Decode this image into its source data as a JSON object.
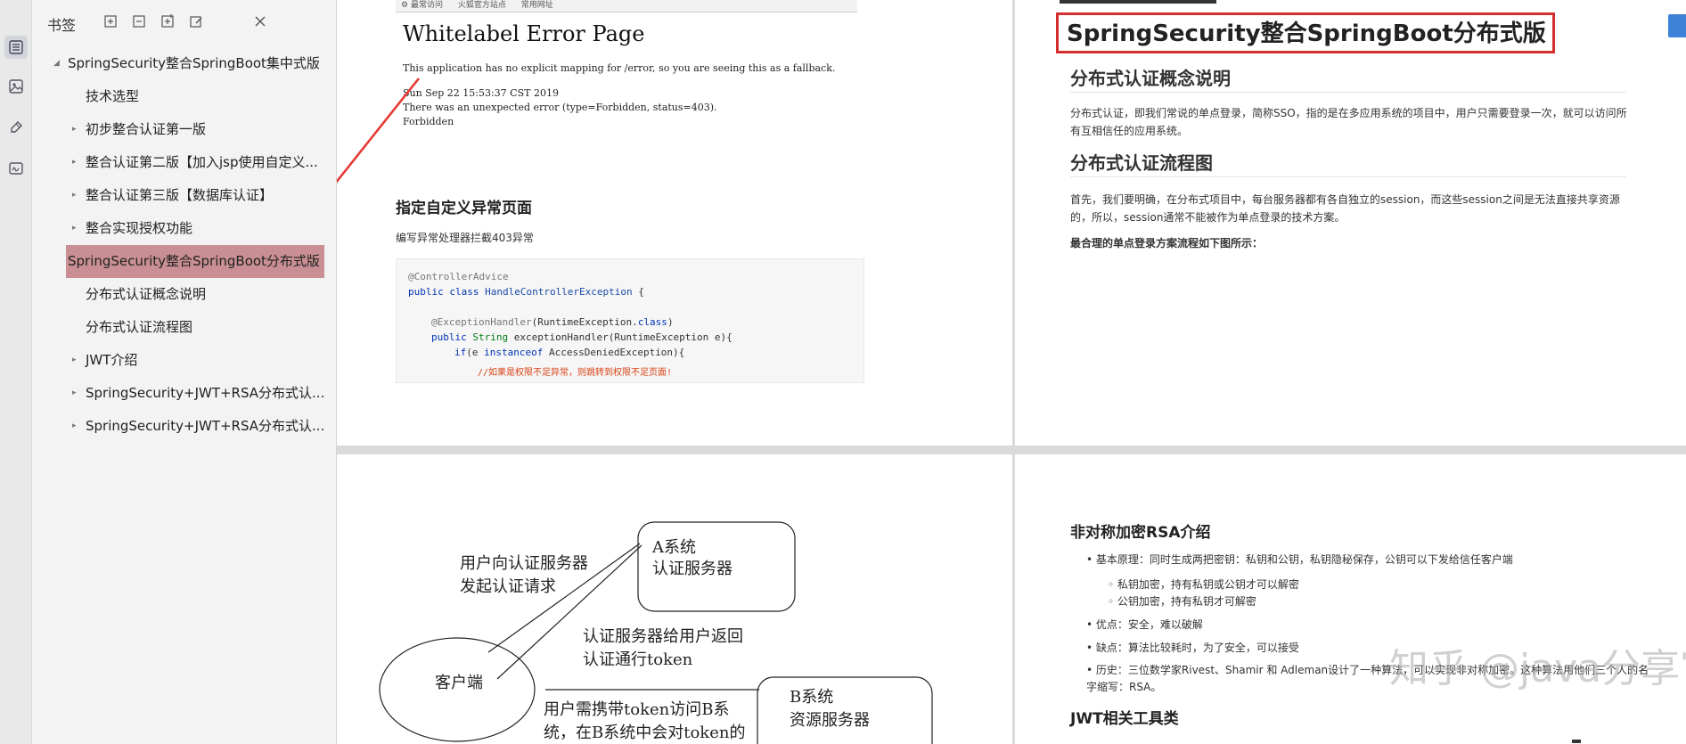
{
  "sidebar": {
    "title": "书签",
    "items": [
      {
        "label": "SpringSecurity整合SpringBoot集中式版",
        "level": 0,
        "arrow": "◢"
      },
      {
        "label": "技术选型",
        "level": 1,
        "arrow": ""
      },
      {
        "label": "初步整合认证第一版",
        "level": 1,
        "arrow": "▸"
      },
      {
        "label": "整合认证第二版【加入jsp使用自定义...",
        "level": 1,
        "arrow": "▸"
      },
      {
        "label": "整合认证第三版【数据库认证】",
        "level": 1,
        "arrow": "▸"
      },
      {
        "label": "整合实现授权功能",
        "level": 1,
        "arrow": "▸"
      },
      {
        "label": "SpringSecurity整合SpringBoot分布式版",
        "level": 0,
        "arrow": "◢",
        "selected": true
      },
      {
        "label": "分布式认证概念说明",
        "level": 1,
        "arrow": ""
      },
      {
        "label": "分布式认证流程图",
        "level": 1,
        "arrow": ""
      },
      {
        "label": "JWT介绍",
        "level": 1,
        "arrow": "▸"
      },
      {
        "label": "SpringSecurity+JWT+RSA分布式认...",
        "level": 1,
        "arrow": "▸"
      },
      {
        "label": "SpringSecurity+JWT+RSA分布式认...",
        "level": 1,
        "arrow": "▸"
      }
    ]
  },
  "page1": {
    "browser_bar": [
      "最常访问",
      "火狐官方站点",
      "常用网址"
    ],
    "error_title": "Whitelabel Error Page",
    "error_line1": "This application has no explicit mapping for /error, so you are seeing this as a fallback.",
    "error_line2": "Sun Sep 22 15:53:37 CST 2019",
    "error_line3": "There was an unexpected error (type=Forbidden, status=403).",
    "error_line4": "Forbidden",
    "heading": "指定自定义异常页面",
    "desc": "编写异常处理器拦截403异常",
    "code": {
      "l1": "@ControllerAdvice",
      "l2_kw": "public class ",
      "l2_cls": "HandleControllerException",
      "l2_end": " {",
      "l3_ann": "@ExceptionHandler",
      "l3_rest": "(RuntimeException.",
      "l3_kw": "class",
      "l3_end": ")",
      "l4_kw": "public ",
      "l4_type": "String",
      "l4_rest": " exceptionHandler(RuntimeException e){",
      "l5_kw": "if",
      "l5_mid": "(e ",
      "l5_kw2": "instanceof",
      "l5_rest": " AccessDeniedException){",
      "l6": "//如果是权限不足异常，则跳转到权限不足页面!"
    }
  },
  "page2": {
    "title": "SpringSecurity整合SpringBoot分布式版",
    "h1": "分布式认证概念说明",
    "p1": "分布式认证，即我们常说的单点登录，简称SSO，指的是在多应用系统的项目中，用户只需要登录一次，就可以访问所有互相信任的应用系统。",
    "h2": "分布式认证流程图",
    "p2": "首先，我们要明确，在分布式项目中，每台服务器都有各自独立的session，而这些session之间是无法直接共享资源的，所以，session通常不能被作为单点登录的技术方案。",
    "p3": "最合理的单点登录方案流程如下图所示："
  },
  "page3": {
    "box_a_l1": "A系统",
    "box_a_l2": "认证服务器",
    "req_l1": "用户向认证服务器",
    "req_l2": "发起认证请求",
    "ret_l1": "认证服务器给用户返回",
    "ret_l2": "认证通行token",
    "client": "客户端",
    "box_b_l1": "B系统",
    "box_b_l2": "资源服务器",
    "access_l1": "用户需携带token访问B系",
    "access_l2": "统，在B系统中会对token的"
  },
  "page4": {
    "h1": "非对称加密RSA介绍",
    "b1": "基本原理：同时生成两把密钥：私钥和公钥，私钥隐秘保存，公钥可以下发给信任客户端",
    "b1a": "私钥加密，持有私钥或公钥才可以解密",
    "b1b": "公钥加密，持有私钥才可解密",
    "b2": "优点：安全，难以破解",
    "b3": "缺点：算法比较耗时，为了安全，可以接受",
    "b4": "历史：三位数学家Rivest、Shamir 和 Adleman设计了一种算法，可以实现非对称加密。这种算法用他们三个人的名字缩写：RSA。",
    "h2": "JWT相关工具类",
    "watermark": "知乎 @java分享官"
  },
  "colors": {
    "selected": "#c98f94",
    "arrow": "#e53935",
    "title_box": "#d32f2f"
  }
}
